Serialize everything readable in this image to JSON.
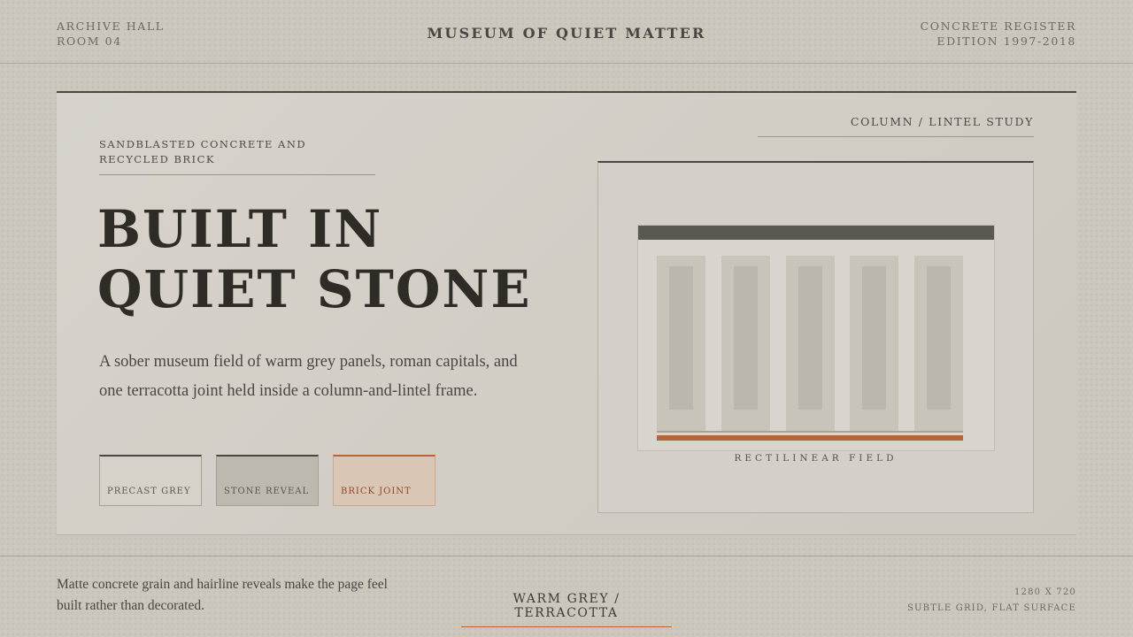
{
  "header": {
    "left_line1": "ARCHIVE HALL",
    "left_line2": "ROOM 04",
    "title": "MUSEUM OF QUIET MATTER",
    "right_line1": "CONCRETE REGISTER",
    "right_line2": "EDITION 1997-2018"
  },
  "hero": {
    "kicker": "SANDBLASTED CONCRETE AND RECYCLED BRICK",
    "headline_line1": "BUILT IN",
    "headline_line2": "QUIET STONE",
    "description": "A sober museum field of warm grey panels, roman capitals, and one terracotta joint held inside a column-and-lintel frame."
  },
  "swatches": [
    {
      "label": "PRECAST GREY",
      "color": "#d6d2ca"
    },
    {
      "label": "STONE REVEAL",
      "color": "#bdb9ae"
    },
    {
      "label": "BRICK JOINT",
      "color": "#b4663a"
    }
  ],
  "study": {
    "label": "COLUMN / LINTEL STUDY",
    "caption": "RECTILINEAR FIELD",
    "lintel_color": "#5b5751",
    "joint_color": "#b4663a"
  },
  "footer": {
    "note": "Matte concrete grain and hairline reveals make the page feel built rather than decorated.",
    "palette": "WARM GREY / TERRACOTTA",
    "size": "1280 X 720",
    "surface": "SUBTLE GRID, FLAT SURFACE"
  }
}
